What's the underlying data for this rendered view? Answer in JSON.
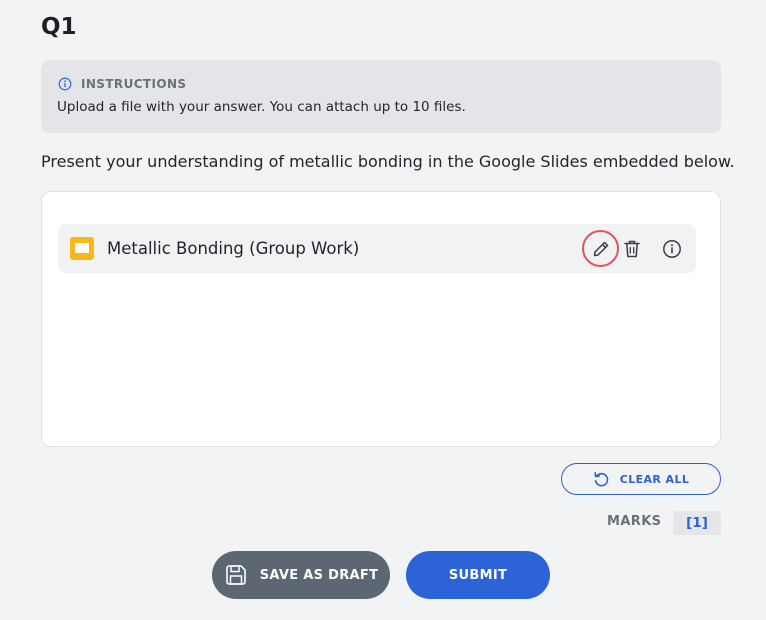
{
  "question": {
    "title": "Q1"
  },
  "instructions": {
    "label": "INSTRUCTIONS",
    "text": "Upload a file with your answer. You can attach up to 10 files.",
    "icon": "info-icon"
  },
  "prompt": "Present your understanding of metallic bonding in the Google Slides embedded below.",
  "attachment": {
    "name": "Metallic Bonding (Group Work)",
    "type_icon": "google-slides-icon",
    "actions": [
      "pencil-icon",
      "trash-icon",
      "info-icon"
    ]
  },
  "actions": {
    "clear_all": "CLEAR ALL",
    "save_draft": "SAVE AS DRAFT",
    "submit": "SUBMIT"
  },
  "marks": {
    "label": "MARKS",
    "value": "[1]"
  },
  "colors": {
    "accent": "#2c63d6",
    "edit_highlight": "#e0555c",
    "slides_yellow": "#f8b918",
    "draft_button": "#5d6673"
  }
}
